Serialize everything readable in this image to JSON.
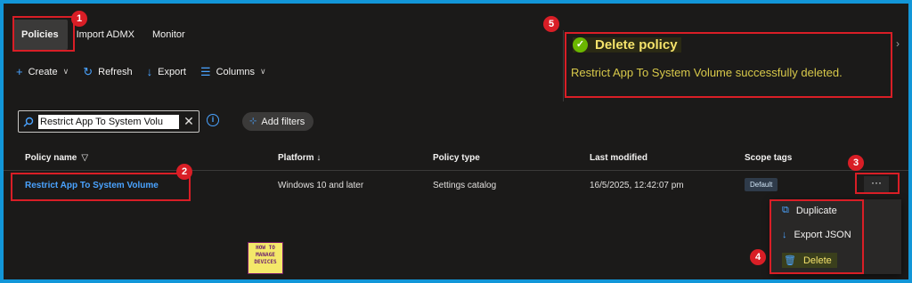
{
  "tabs": [
    {
      "label": "Policies",
      "active": true
    },
    {
      "label": "Import ADMX",
      "active": false
    },
    {
      "label": "Monitor",
      "active": false
    }
  ],
  "toolbar": {
    "create": "Create",
    "refresh": "Refresh",
    "export": "Export",
    "columns": "Columns"
  },
  "search": {
    "value": "Restrict App To System Volu"
  },
  "filters": {
    "label": "Add filters"
  },
  "table": {
    "headers": {
      "policy_name": "Policy name",
      "platform": "Platform ↓",
      "policy_type": "Policy type",
      "last_modified": "Last modified",
      "scope_tags": "Scope tags"
    },
    "row": {
      "policy_name": "Restrict App To System Volume",
      "platform": "Windows 10 and later",
      "policy_type": "Settings catalog",
      "last_modified": "16/5/2025, 12:42:07 pm",
      "scope_tag": "Default",
      "more": "···"
    }
  },
  "context_menu": {
    "items": [
      {
        "label": "Duplicate",
        "icon": "duplicate-icon"
      },
      {
        "label": "Export JSON",
        "icon": "download-icon"
      },
      {
        "label": "Delete",
        "icon": "trash-icon"
      }
    ]
  },
  "toast": {
    "title": "Delete policy",
    "message": "Restrict App To System Volume successfully deleted."
  },
  "annotations": [
    "1",
    "2",
    "3",
    "4",
    "5"
  ],
  "logo": {
    "text": "HOW TO MANAGE DEVICES"
  },
  "colors": {
    "accent": "#4aa3ff",
    "highlight": "#d91e26",
    "success": "#6bb700",
    "background": "#1b1a19",
    "frame": "#1296d8"
  }
}
